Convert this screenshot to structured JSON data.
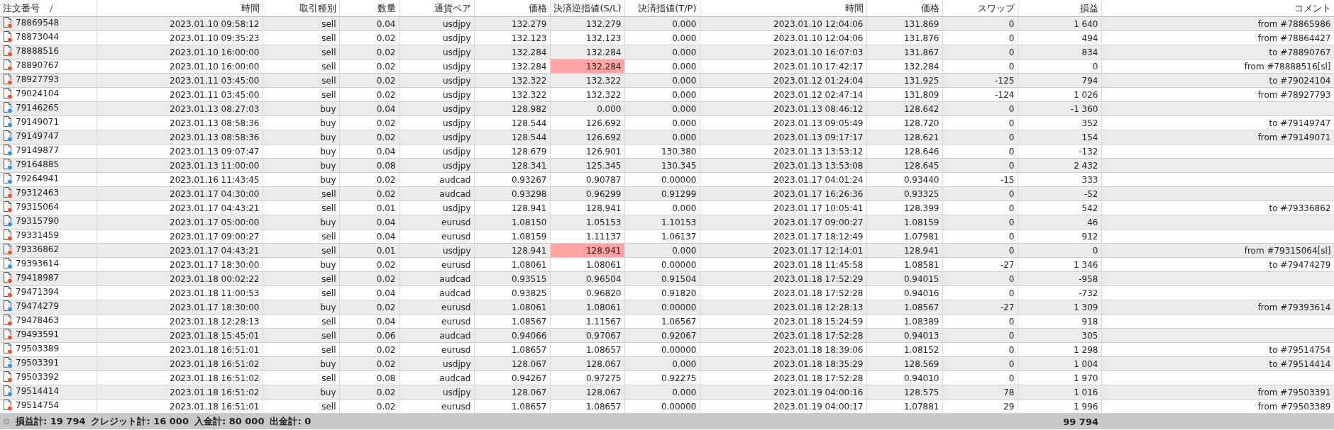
{
  "table": {
    "sort_mark": "/",
    "columns": [
      "注文番号",
      "時間",
      "取引種別",
      "数量",
      "通貨ペア",
      "価格",
      "決済逆指値(S/L)",
      "決済指値(T/P)",
      "時間",
      "価格",
      "スワップ",
      "損益",
      "コメント"
    ],
    "rows": [
      {
        "kind": "sell",
        "sl_hit": false,
        "cells": [
          "78869548",
          "2023.01.10 09:58:12",
          "sell",
          "0.04",
          "usdjpy",
          "132.279",
          "132.279",
          "0.000",
          "2023.01.10 12:04:06",
          "131.869",
          "0",
          "1 640"
        ],
        "comment": "from #78865986"
      },
      {
        "kind": "sell",
        "sl_hit": false,
        "cells": [
          "78873044",
          "2023.01.10 09:35:23",
          "sell",
          "0.02",
          "usdjpy",
          "132.123",
          "132.123",
          "0.000",
          "2023.01.10 12:04:06",
          "131.876",
          "0",
          "494"
        ],
        "comment": "from #78864427"
      },
      {
        "kind": "sell",
        "sl_hit": false,
        "cells": [
          "78888516",
          "2023.01.10 16:00:00",
          "sell",
          "0.02",
          "usdjpy",
          "132.284",
          "132.284",
          "0.000",
          "2023.01.10 16:07:03",
          "131.867",
          "0",
          "834"
        ],
        "comment": "to #78890767"
      },
      {
        "kind": "sell",
        "sl_hit": true,
        "cells": [
          "78890767",
          "2023.01.10 16:00:00",
          "sell",
          "0.02",
          "usdjpy",
          "132.284",
          "132.284",
          "0.000",
          "2023.01.10 17:42:17",
          "132.284",
          "0",
          "0"
        ],
        "comment": "from #78888516[sl]"
      },
      {
        "kind": "sell",
        "sl_hit": false,
        "cells": [
          "78927793",
          "2023.01.11 03:45:00",
          "sell",
          "0.02",
          "usdjpy",
          "132.322",
          "132.322",
          "0.000",
          "2023.01.12 01:24:04",
          "131.925",
          "-125",
          "794"
        ],
        "comment": "to #79024104"
      },
      {
        "kind": "sell",
        "sl_hit": false,
        "cells": [
          "79024104",
          "2023.01.11 03:45:00",
          "sell",
          "0.02",
          "usdjpy",
          "132.322",
          "132.322",
          "0.000",
          "2023.01.12 02:47:14",
          "131.809",
          "-124",
          "1 026"
        ],
        "comment": "from #78927793"
      },
      {
        "kind": "buy",
        "sl_hit": false,
        "cells": [
          "79146265",
          "2023.01.13 08:27:03",
          "buy",
          "0.04",
          "usdjpy",
          "128.982",
          "0.000",
          "0.000",
          "2023.01.13 08:46:12",
          "128.642",
          "0",
          "-1 360"
        ]
      },
      {
        "kind": "buy",
        "sl_hit": false,
        "cells": [
          "79149071",
          "2023.01.13 08:58:36",
          "buy",
          "0.02",
          "usdjpy",
          "128.544",
          "126.692",
          "0.000",
          "2023.01.13 09:05:49",
          "128.720",
          "0",
          "352"
        ],
        "comment": "to #79149747"
      },
      {
        "kind": "buy",
        "sl_hit": false,
        "cells": [
          "79149747",
          "2023.01.13 08:58:36",
          "buy",
          "0.02",
          "usdjpy",
          "128.544",
          "126.692",
          "0.000",
          "2023.01.13 09:17:17",
          "128.621",
          "0",
          "154"
        ],
        "comment": "from #79149071"
      },
      {
        "kind": "buy",
        "sl_hit": false,
        "cells": [
          "79149877",
          "2023.01.13 09:07:47",
          "buy",
          "0.04",
          "usdjpy",
          "128.679",
          "126.901",
          "130.380",
          "2023.01.13 13:53:12",
          "128.646",
          "0",
          "-132"
        ]
      },
      {
        "kind": "buy",
        "sl_hit": false,
        "cells": [
          "79164885",
          "2023.01.13 11:00:00",
          "buy",
          "0.08",
          "usdjpy",
          "128.341",
          "125.345",
          "130.345",
          "2023.01.13 13:53:08",
          "128.645",
          "0",
          "2 432"
        ]
      },
      {
        "kind": "buy",
        "sl_hit": false,
        "cells": [
          "79264941",
          "2023.01.16 11:43:45",
          "buy",
          "0.02",
          "audcad",
          "0.93267",
          "0.90787",
          "0.00000",
          "2023.01.17 04:01:24",
          "0.93440",
          "-15",
          "333"
        ]
      },
      {
        "kind": "sell",
        "sl_hit": false,
        "cells": [
          "79312463",
          "2023.01.17 04:30:00",
          "sell",
          "0.02",
          "audcad",
          "0.93298",
          "0.96299",
          "0.91299",
          "2023.01.17 16:26:36",
          "0.93325",
          "0",
          "-52"
        ]
      },
      {
        "kind": "sell",
        "sl_hit": false,
        "cells": [
          "79315064",
          "2023.01.17 04:43:21",
          "sell",
          "0.01",
          "usdjpy",
          "128.941",
          "128.941",
          "0.000",
          "2023.01.17 10:05:41",
          "128.399",
          "0",
          "542"
        ],
        "comment": "to #79336862"
      },
      {
        "kind": "buy",
        "sl_hit": false,
        "cells": [
          "79315790",
          "2023.01.17 05:00:00",
          "buy",
          "0.04",
          "eurusd",
          "1.08150",
          "1.05153",
          "1.10153",
          "2023.01.17 09:00:27",
          "1.08159",
          "0",
          "46"
        ]
      },
      {
        "kind": "sell",
        "sl_hit": false,
        "cells": [
          "79331459",
          "2023.01.17 09:00:27",
          "sell",
          "0.04",
          "eurusd",
          "1.08159",
          "1.11137",
          "1.06137",
          "2023.01.17 18:12:49",
          "1.07981",
          "0",
          "912"
        ]
      },
      {
        "kind": "sell",
        "sl_hit": true,
        "cells": [
          "79336862",
          "2023.01.17 04:43:21",
          "sell",
          "0.01",
          "usdjpy",
          "128.941",
          "128.941",
          "0.000",
          "2023.01.17 12:14:01",
          "128.941",
          "0",
          "0"
        ],
        "comment": "from #79315064[sl]"
      },
      {
        "kind": "buy",
        "sl_hit": false,
        "cells": [
          "79393614",
          "2023.01.17 18:30:00",
          "buy",
          "0.02",
          "eurusd",
          "1.08061",
          "1.08061",
          "0.00000",
          "2023.01.18 11:45:58",
          "1.08581",
          "-27",
          "1 346"
        ],
        "comment": "to #79474279"
      },
      {
        "kind": "sell",
        "sl_hit": false,
        "cells": [
          "79418987",
          "2023.01.18 00:02:22",
          "sell",
          "0.02",
          "audcad",
          "0.93515",
          "0.96504",
          "0.91504",
          "2023.01.18 17:52:29",
          "0.94015",
          "0",
          "-958"
        ]
      },
      {
        "kind": "sell",
        "sl_hit": false,
        "cells": [
          "79471394",
          "2023.01.18 11:00:53",
          "sell",
          "0.04",
          "audcad",
          "0.93825",
          "0.96820",
          "0.91820",
          "2023.01.18 17:52:28",
          "0.94016",
          "0",
          "-732"
        ]
      },
      {
        "kind": "buy",
        "sl_hit": false,
        "cells": [
          "79474279",
          "2023.01.17 18:30:00",
          "buy",
          "0.02",
          "eurusd",
          "1.08061",
          "1.08061",
          "0.00000",
          "2023.01.18 12:28:13",
          "1.08567",
          "-27",
          "1 309"
        ],
        "comment": "from #79393614"
      },
      {
        "kind": "sell",
        "sl_hit": false,
        "cells": [
          "79478463",
          "2023.01.18 12:28:13",
          "sell",
          "0.04",
          "eurusd",
          "1.08567",
          "1.11567",
          "1.06567",
          "2023.01.18 15:24:59",
          "1.08389",
          "0",
          "918"
        ]
      },
      {
        "kind": "sell",
        "sl_hit": false,
        "cells": [
          "79493591",
          "2023.01.18 15:45:01",
          "sell",
          "0.06",
          "audcad",
          "0.94066",
          "0.97067",
          "0.92067",
          "2023.01.18 17:52:28",
          "0.94013",
          "0",
          "305"
        ]
      },
      {
        "kind": "sell",
        "sl_hit": false,
        "cells": [
          "79503389",
          "2023.01.18 16:51:01",
          "sell",
          "0.02",
          "eurusd",
          "1.08657",
          "1.08657",
          "0.00000",
          "2023.01.18 18:39:06",
          "1.08152",
          "0",
          "1 298"
        ],
        "comment": "to #79514754"
      },
      {
        "kind": "buy",
        "sl_hit": false,
        "cells": [
          "79503391",
          "2023.01.18 16:51:02",
          "buy",
          "0.02",
          "usdjpy",
          "128.067",
          "128.067",
          "0.000",
          "2023.01.18 18:35:29",
          "128.569",
          "0",
          "1 004"
        ],
        "comment": "to #79514414"
      },
      {
        "kind": "sell",
        "sl_hit": false,
        "cells": [
          "79503392",
          "2023.01.18 16:51:02",
          "sell",
          "0.08",
          "audcad",
          "0.94267",
          "0.97275",
          "0.92275",
          "2023.01.18 17:52:28",
          "0.94010",
          "0",
          "1 970"
        ]
      },
      {
        "kind": "buy",
        "sl_hit": false,
        "cells": [
          "79514414",
          "2023.01.18 16:51:02",
          "buy",
          "0.02",
          "usdjpy",
          "128.067",
          "128.067",
          "0.000",
          "2023.01.19 04:00:16",
          "128.575",
          "78",
          "1 016"
        ],
        "comment": "from #79503391"
      },
      {
        "kind": "sell",
        "sl_hit": false,
        "cells": [
          "79514754",
          "2023.01.18 16:51:01",
          "sell",
          "0.02",
          "eurusd",
          "1.08657",
          "1.08657",
          "0.00000",
          "2023.01.19 04:00:17",
          "1.07881",
          "29",
          "1 996"
        ],
        "comment": "from #79503389"
      }
    ]
  },
  "status_bar": {
    "totals": [
      "損益計: 19 794",
      "クレジット計: 16 000",
      "入金計: 80 000",
      "出金計: 0"
    ],
    "profit_total": "99 794"
  }
}
